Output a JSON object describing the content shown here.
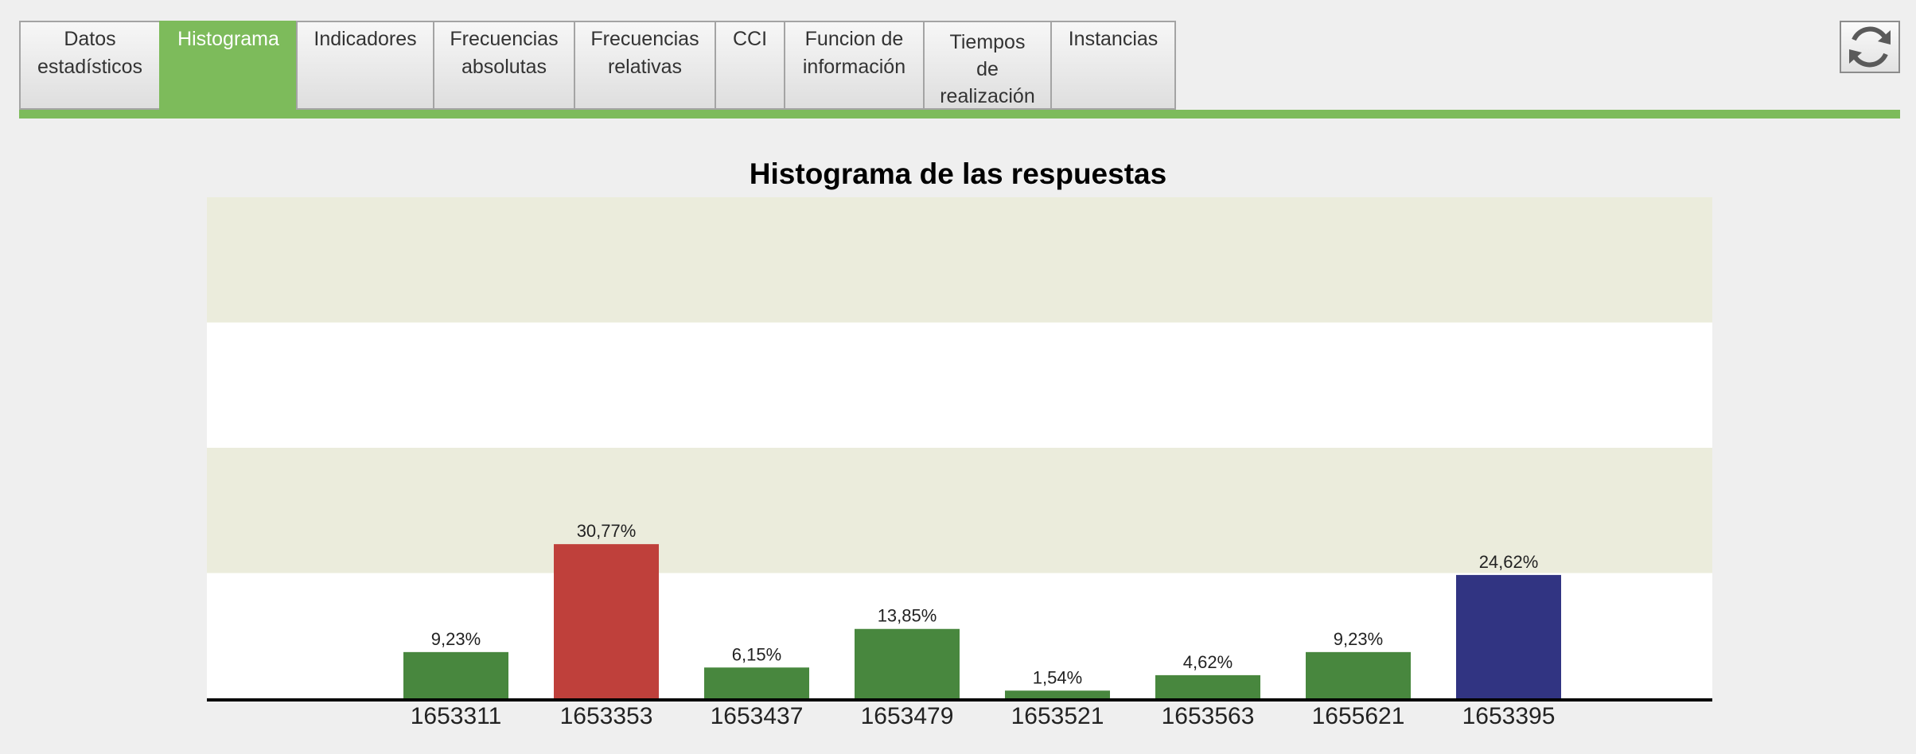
{
  "tabs": [
    {
      "label": "Datos\nestadísticos",
      "active": false
    },
    {
      "label": "Histograma",
      "active": true
    },
    {
      "label": "Indicadores",
      "active": false
    },
    {
      "label": "Frecuencias\nabsolutas",
      "active": false
    },
    {
      "label": "Frecuencias\nrelativas",
      "active": false
    },
    {
      "label": "CCI",
      "active": false
    },
    {
      "label": "Funcion de\ninformación",
      "active": false
    },
    {
      "label": "Tiempos\nde\nrealización",
      "active": false
    },
    {
      "label": "Instancias",
      "active": false
    }
  ],
  "toolbar": {
    "refresh_icon": "refresh-icon"
  },
  "colors": {
    "accent": "#7dbb5b",
    "band": "#ebecdc",
    "bar_green": "#48873e",
    "bar_red": "#bf403b",
    "bar_blue": "#313482"
  },
  "chart_data": {
    "type": "bar",
    "title": "Histograma de las respuestas",
    "categories": [
      "1653311",
      "1653353",
      "1653437",
      "1653479",
      "1653521",
      "1653563",
      "1655621",
      "1653395"
    ],
    "values": [
      9.23,
      30.77,
      6.15,
      13.85,
      1.54,
      4.62,
      9.23,
      24.62
    ],
    "value_labels": [
      "9,23%",
      "30,77%",
      "6,15%",
      "13,85%",
      "1,54%",
      "4,62%",
      "9,23%",
      "24,62%"
    ],
    "bar_colors": [
      "#48873e",
      "#bf403b",
      "#48873e",
      "#48873e",
      "#48873e",
      "#48873e",
      "#48873e",
      "#313482"
    ],
    "ylim": [
      0,
      100
    ],
    "grid_bands": true,
    "xlabel": "",
    "ylabel": ""
  }
}
